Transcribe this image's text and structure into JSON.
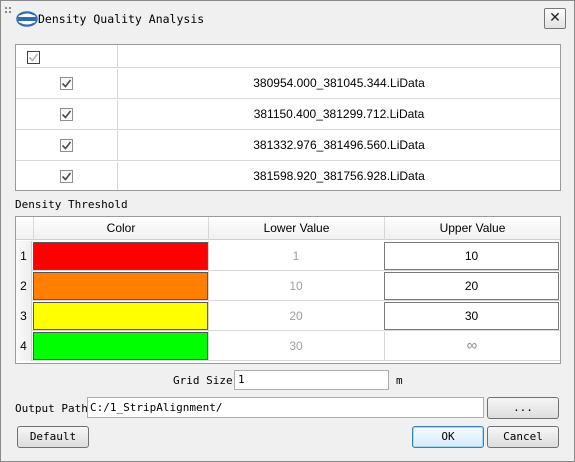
{
  "window": {
    "title": "Density Quality Analysis",
    "close_glyph": "✕"
  },
  "files": {
    "header_checked": true,
    "rows": [
      {
        "checked": true,
        "name": "380954.000_381045.344.LiData"
      },
      {
        "checked": true,
        "name": "381150.400_381299.712.LiData"
      },
      {
        "checked": true,
        "name": "381332.976_381496.560.LiData"
      },
      {
        "checked": true,
        "name": "381598.920_381756.928.LiData"
      }
    ]
  },
  "threshold": {
    "section_label": "Density Threshold",
    "columns": [
      "Color",
      "Lower Value",
      "Upper Value"
    ],
    "rows": [
      {
        "index": "1",
        "color": "#ff0000",
        "lower": "1",
        "upper": "10"
      },
      {
        "index": "2",
        "color": "#ff8000",
        "lower": "10",
        "upper": "20"
      },
      {
        "index": "3",
        "color": "#ffff00",
        "lower": "20",
        "upper": "30"
      },
      {
        "index": "4",
        "color": "#00ff00",
        "lower": "30",
        "upper": "∞"
      }
    ]
  },
  "grid": {
    "label": "Grid Size",
    "value": "1",
    "unit": "m"
  },
  "output": {
    "label": "Output Path:",
    "value": "C:/1_StripAlignment/",
    "browse_label": "..."
  },
  "buttons": {
    "default_label": "Default",
    "ok_label": "OK",
    "cancel_label": "Cancel"
  },
  "icons": {
    "grip": "grip-icon",
    "logo": "app-logo-icon",
    "close": "close-icon",
    "check": "checkmark-icon"
  }
}
